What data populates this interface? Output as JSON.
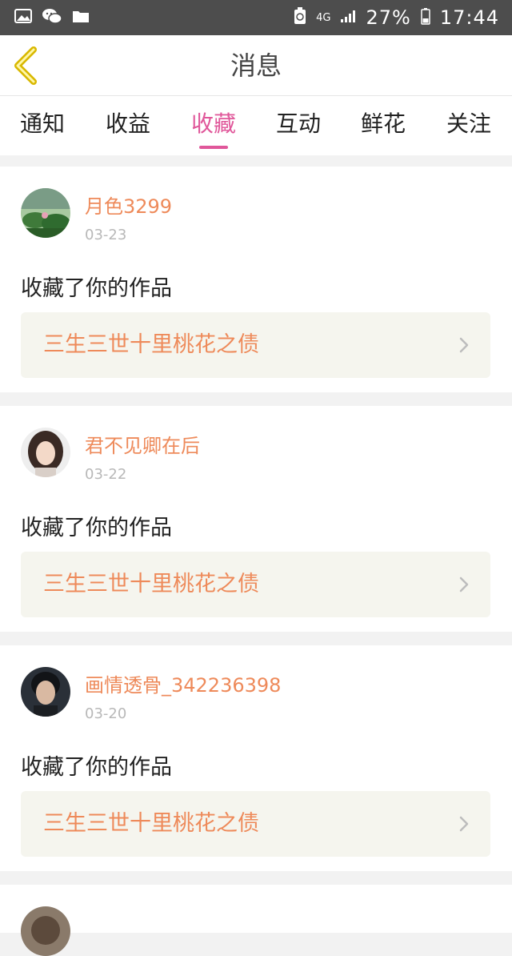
{
  "status_bar": {
    "left_icons": [
      "image-icon",
      "wechat-icon",
      "folder-icon"
    ],
    "network": "4G",
    "battery": "27%",
    "time": "17:44"
  },
  "header": {
    "title": "消息"
  },
  "tabs": [
    {
      "label": "通知",
      "active": false
    },
    {
      "label": "收益",
      "active": false
    },
    {
      "label": "收藏",
      "active": true
    },
    {
      "label": "互动",
      "active": false
    },
    {
      "label": "鲜花",
      "active": false
    },
    {
      "label": "关注",
      "active": false
    }
  ],
  "colors": {
    "accent": "#e0579a",
    "name": "#ee8a5a",
    "status_bar": "#4d4d4d"
  },
  "items": [
    {
      "username": "月色3299",
      "date": "03-23",
      "action": "收藏了你的作品",
      "work_title": "三生三世十里桃花之债"
    },
    {
      "username": "君不见卿在后",
      "date": "03-22",
      "action": "收藏了你的作品",
      "work_title": "三生三世十里桃花之债"
    },
    {
      "username": "画情透骨_342236398",
      "date": "03-20",
      "action": "收藏了你的作品",
      "work_title": "三生三世十里桃花之债"
    }
  ]
}
